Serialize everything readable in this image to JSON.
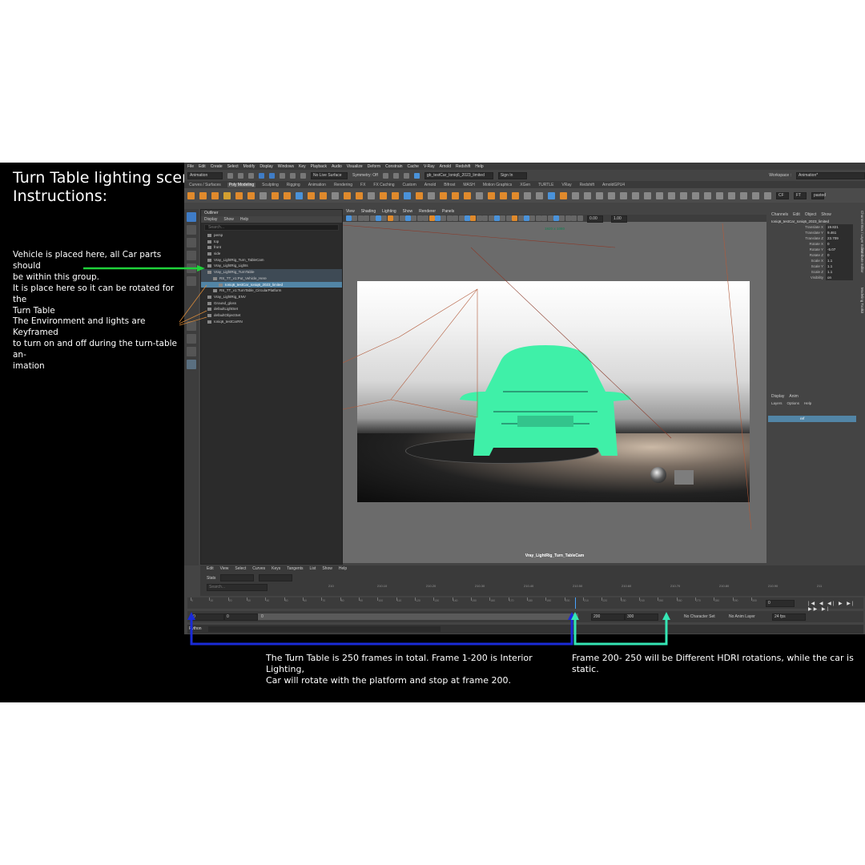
{
  "instructions": {
    "title_line1": "Turn Table lighting scene",
    "title_line2": "Instructions:",
    "vehicle_note": "Vehicle is placed here, all Car parts should\nbe within this group.\nIt is place here so it can be rotated for the\nTurn Table",
    "env_note": "The Environment and lights are Keyframed\nto turn on and off during the turn-table an-\nimation",
    "frames_note": "The Turn Table is 250 frames in total.  Frame 1-200 is Interior Lighting,\nCar will rotate with the platform and stop at frame 200.",
    "hdri_note": "Frame 200- 250 will be Different HDRI rotations, while the car is static."
  },
  "maya": {
    "menus": [
      "File",
      "Edit",
      "Create",
      "Select",
      "Modify",
      "Display",
      "Windows",
      "Key",
      "Playback",
      "Audio",
      "Visualize",
      "Deform",
      "Constrain",
      "Cache",
      "V-Ray",
      "Arnold",
      "Redshift",
      "Help"
    ],
    "workspace_label": "Workspace :",
    "workspace_value": "Animation*",
    "mode_menu": "Animation",
    "live_surface": "No Live Surface",
    "symmetry": "Symmetry: Off",
    "file_name": "gb_testCar_Ioniq6_2023_limited",
    "sign_in": "Sign In",
    "shelf_tabs": [
      "Curves / Surfaces",
      "Poly Modeling",
      "Sculpting",
      "Rigging",
      "Animation",
      "Rendering",
      "FX",
      "FX Caching",
      "Custom",
      "Arnold",
      "Bifrost",
      "MASH",
      "Motion Graphics",
      "XGen",
      "TURTLE",
      "VRay",
      "Redshift",
      "ArnoldGPU4"
    ],
    "active_shelf": "Poly Modeling",
    "shelf_badges": [
      "CF",
      "FT",
      "pasted"
    ],
    "outliner": {
      "title": "Outliner",
      "menu": [
        "Display",
        "Show",
        "Help"
      ],
      "search_placeholder": "Search...",
      "items": [
        {
          "label": "persp",
          "indent": 0,
          "state": ""
        },
        {
          "label": "top",
          "indent": 0,
          "state": ""
        },
        {
          "label": "front",
          "indent": 0,
          "state": ""
        },
        {
          "label": "side",
          "indent": 0,
          "state": ""
        },
        {
          "label": "Vray_LightRig_Turn_TableCam",
          "indent": 0,
          "state": ""
        },
        {
          "label": "Vray_LightRig_Lights",
          "indent": 0,
          "state": ""
        },
        {
          "label": "Vray_LightRig_TurnTable",
          "indent": 0,
          "state": "hl"
        },
        {
          "label": "RS_TT_v1:Put_Vehicle_Here",
          "indent": 1,
          "state": "hl"
        },
        {
          "label": "Ioniq6_testCar_Ioniq6_2023_limited",
          "indent": 2,
          "state": "sel"
        },
        {
          "label": "RS_TT_v1:TurnTable_CircularPlatform",
          "indent": 1,
          "state": ""
        },
        {
          "label": "Vray_LightRig_ENV",
          "indent": 0,
          "state": ""
        },
        {
          "label": "Ground_gloss",
          "indent": 0,
          "state": ""
        },
        {
          "label": "defaultLightSet",
          "indent": 0,
          "state": ""
        },
        {
          "label": "defaultObjectSet",
          "indent": 0,
          "state": ""
        },
        {
          "label": "Ioniq6_testCarRN",
          "indent": 0,
          "state": ""
        }
      ]
    },
    "viewport": {
      "menu": [
        "View",
        "Shading",
        "Lighting",
        "Show",
        "Renderer",
        "Panels"
      ],
      "field_a": "0.00",
      "field_b": "1.00",
      "resolution": "1920 x 1080",
      "camera": "Vray_LightRig_Turn_TableCam"
    },
    "channel_box": {
      "menu": [
        "Channels",
        "Edit",
        "Object",
        "Show"
      ],
      "object": "Ioniq6_testCar_Ioniq6_2023_limited",
      "attrs": [
        {
          "name": "Translate X",
          "value": "19.821"
        },
        {
          "name": "Translate Y",
          "value": "9.461"
        },
        {
          "name": "Translate Z",
          "value": "23.709"
        },
        {
          "name": "Rotate X",
          "value": "0"
        },
        {
          "name": "Rotate Y",
          "value": "-5.07"
        },
        {
          "name": "Rotate Z",
          "value": "0"
        },
        {
          "name": "Scale X",
          "value": "1.1"
        },
        {
          "name": "Scale Y",
          "value": "1.1"
        },
        {
          "name": "Scale Z",
          "value": "1.1"
        },
        {
          "name": "Visibility",
          "value": "on"
        }
      ],
      "side_tabs": [
        "Channel Box / Layer Editor",
        "Attribute Editor",
        "Modeling Toolkit"
      ]
    },
    "layer_editor": {
      "tabs": [
        "Display",
        "Anim"
      ],
      "menu": [
        "Layers",
        "Options",
        "Help"
      ],
      "layer": "ref"
    },
    "graph_editor": {
      "menu": [
        "Edit",
        "View",
        "Select",
        "Curves",
        "Keys",
        "Tangents",
        "List",
        "Show",
        "Help"
      ],
      "stats": "Stats",
      "search_placeholder": "Search...",
      "ruler": [
        "210",
        "210.10",
        "210.20",
        "210.30",
        "210.40",
        "210.50",
        "210.60",
        "210.70",
        "210.80",
        "210.90",
        "211"
      ]
    },
    "timeline": {
      "ticks": [
        "0",
        "10",
        "20",
        "30",
        "40",
        "50",
        "60",
        "70",
        "80",
        "90",
        "100",
        "110",
        "120",
        "130",
        "140",
        "150",
        "160",
        "170",
        "180",
        "190",
        "200",
        "210",
        "220",
        "230",
        "240",
        "250",
        "260",
        "270",
        "280",
        "290",
        "300"
      ],
      "current_frame": "0"
    },
    "range": {
      "start": "0",
      "playback_start": "0",
      "slider_start": "0",
      "end": "200",
      "playback_end": "300",
      "anim_end": "300",
      "character_set": "No Character Set",
      "anim_layer": "No Anim Layer",
      "fps": "24 fps"
    },
    "command_line": "Python"
  },
  "colors": {
    "arrow_green": "#1fd13a",
    "arrow_blue": "#1a2bd8",
    "arrow_teal": "#35e6b4",
    "car_color": "#3ff0a8",
    "selection": "#5285a6"
  }
}
